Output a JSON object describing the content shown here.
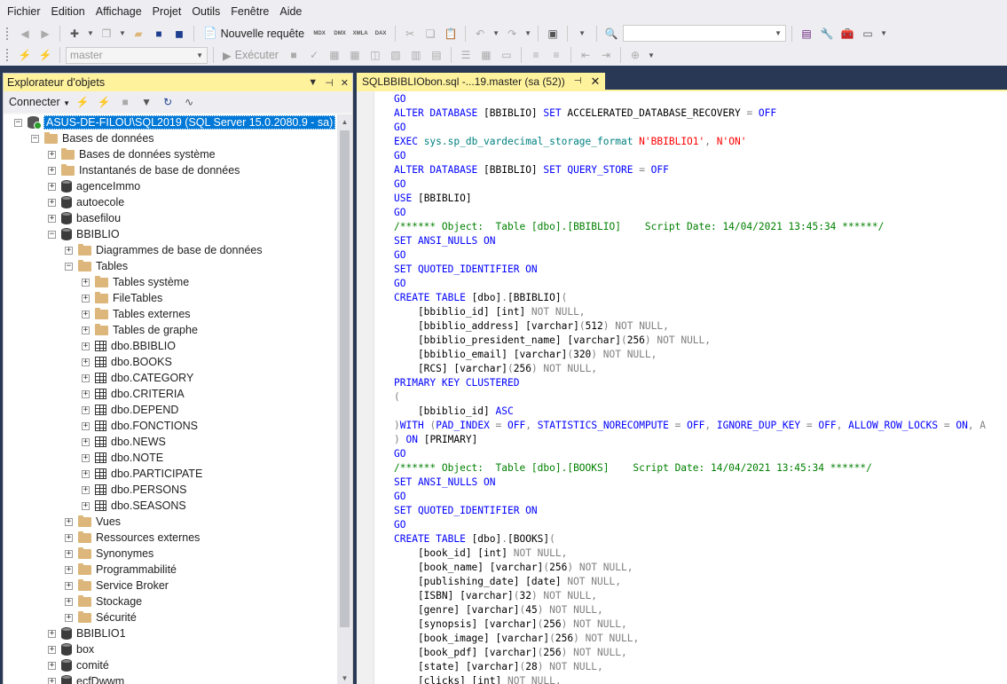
{
  "menu": [
    "Fichier",
    "Edition",
    "Affichage",
    "Projet",
    "Outils",
    "Fenêtre",
    "Aide"
  ],
  "toolbar1": {
    "new_query_label": "Nouvelle requête",
    "mini_labels": [
      "MDX",
      "DMX",
      "XMLA",
      "DAX"
    ],
    "search_value": ""
  },
  "toolbar2": {
    "database_combo": "master",
    "execute_label": "Exécuter"
  },
  "explorer": {
    "title": "Explorateur d'objets",
    "connect_label": "Connecter",
    "tree": [
      {
        "depth": 0,
        "exp": "⊟",
        "icon": "server",
        "label": "ASUS-DE-FILOU\\SQL2019 (SQL Server 15.0.2080.9 - sa)",
        "selected": true
      },
      {
        "depth": 1,
        "exp": "⊟",
        "icon": "folder",
        "label": "Bases de données"
      },
      {
        "depth": 2,
        "exp": "⊞",
        "icon": "folder",
        "label": "Bases de données système"
      },
      {
        "depth": 2,
        "exp": "⊞",
        "icon": "folder",
        "label": "Instantanés de base de données"
      },
      {
        "depth": 2,
        "exp": "⊞",
        "icon": "db",
        "label": "agenceImmo"
      },
      {
        "depth": 2,
        "exp": "⊞",
        "icon": "db",
        "label": "autoecole"
      },
      {
        "depth": 2,
        "exp": "⊞",
        "icon": "db",
        "label": "basefilou"
      },
      {
        "depth": 2,
        "exp": "⊟",
        "icon": "db",
        "label": "BBIBLIO"
      },
      {
        "depth": 3,
        "exp": "⊞",
        "icon": "folder",
        "label": "Diagrammes de base de données"
      },
      {
        "depth": 3,
        "exp": "⊟",
        "icon": "folder",
        "label": "Tables"
      },
      {
        "depth": 4,
        "exp": "⊞",
        "icon": "folder",
        "label": "Tables système"
      },
      {
        "depth": 4,
        "exp": "⊞",
        "icon": "folder",
        "label": "FileTables"
      },
      {
        "depth": 4,
        "exp": "⊞",
        "icon": "folder",
        "label": "Tables externes"
      },
      {
        "depth": 4,
        "exp": "⊞",
        "icon": "folder",
        "label": "Tables de graphe"
      },
      {
        "depth": 4,
        "exp": "⊞",
        "icon": "table",
        "label": "dbo.BBIBLIO"
      },
      {
        "depth": 4,
        "exp": "⊞",
        "icon": "table",
        "label": "dbo.BOOKS"
      },
      {
        "depth": 4,
        "exp": "⊞",
        "icon": "table",
        "label": "dbo.CATEGORY"
      },
      {
        "depth": 4,
        "exp": "⊞",
        "icon": "table",
        "label": "dbo.CRITERIA"
      },
      {
        "depth": 4,
        "exp": "⊞",
        "icon": "table",
        "label": "dbo.DEPEND"
      },
      {
        "depth": 4,
        "exp": "⊞",
        "icon": "table",
        "label": "dbo.FONCTIONS"
      },
      {
        "depth": 4,
        "exp": "⊞",
        "icon": "table",
        "label": "dbo.NEWS"
      },
      {
        "depth": 4,
        "exp": "⊞",
        "icon": "table",
        "label": "dbo.NOTE"
      },
      {
        "depth": 4,
        "exp": "⊞",
        "icon": "table",
        "label": "dbo.PARTICIPATE"
      },
      {
        "depth": 4,
        "exp": "⊞",
        "icon": "table",
        "label": "dbo.PERSONS"
      },
      {
        "depth": 4,
        "exp": "⊞",
        "icon": "table",
        "label": "dbo.SEASONS"
      },
      {
        "depth": 3,
        "exp": "⊞",
        "icon": "folder",
        "label": "Vues"
      },
      {
        "depth": 3,
        "exp": "⊞",
        "icon": "folder",
        "label": "Ressources externes"
      },
      {
        "depth": 3,
        "exp": "⊞",
        "icon": "folder",
        "label": "Synonymes"
      },
      {
        "depth": 3,
        "exp": "⊞",
        "icon": "folder",
        "label": "Programmabilité"
      },
      {
        "depth": 3,
        "exp": "⊞",
        "icon": "folder",
        "label": "Service Broker"
      },
      {
        "depth": 3,
        "exp": "⊞",
        "icon": "folder",
        "label": "Stockage"
      },
      {
        "depth": 3,
        "exp": "⊞",
        "icon": "folder",
        "label": "Sécurité"
      },
      {
        "depth": 2,
        "exp": "⊞",
        "icon": "db",
        "label": "BBIBLIO1"
      },
      {
        "depth": 2,
        "exp": "⊞",
        "icon": "db",
        "label": "box"
      },
      {
        "depth": 2,
        "exp": "⊞",
        "icon": "db",
        "label": "comité"
      },
      {
        "depth": 2,
        "exp": "⊞",
        "icon": "db",
        "label": "ecfDwwm"
      }
    ]
  },
  "editor": {
    "tab_title": "SQLBBIBLIObon.sql -...19.master (sa (52))",
    "lines": [
      [
        [
          "kw",
          "GO"
        ]
      ],
      [
        [
          "kw",
          "ALTER DATABASE "
        ],
        [
          "id",
          "[BBIBLIO] "
        ],
        [
          "kw",
          "SET "
        ],
        [
          "id",
          "ACCELERATED_DATABASE_RECOVERY "
        ],
        [
          "gr",
          "= "
        ],
        [
          "kw",
          "OFF"
        ]
      ],
      [
        [
          "kw",
          "GO"
        ]
      ],
      [
        [
          "kw",
          "EXEC "
        ],
        [
          "fn",
          "sys.sp_db_vardecimal_storage_format "
        ],
        [
          "st",
          "N'BBIBLIO1'"
        ],
        [
          "gr",
          ", "
        ],
        [
          "st",
          "N'ON'"
        ]
      ],
      [
        [
          "kw",
          "GO"
        ]
      ],
      [
        [
          "kw",
          "ALTER DATABASE "
        ],
        [
          "id",
          "[BBIBLIO] "
        ],
        [
          "kw",
          "SET "
        ],
        [
          "kw",
          "QUERY_STORE "
        ],
        [
          "gr",
          "= "
        ],
        [
          "kw",
          "OFF"
        ]
      ],
      [
        [
          "kw",
          "GO"
        ]
      ],
      [
        [
          "kw",
          "USE "
        ],
        [
          "id",
          "[BBIBLIO]"
        ]
      ],
      [
        [
          "kw",
          "GO"
        ]
      ],
      [
        [
          "cm",
          "/****** Object:  Table [dbo].[BBIBLIO]    Script Date: 14/04/2021 13:45:34 ******/"
        ]
      ],
      [
        [
          "kw",
          "SET ANSI_NULLS ON"
        ]
      ],
      [
        [
          "kw",
          "GO"
        ]
      ],
      [
        [
          "kw",
          "SET QUOTED_IDENTIFIER ON"
        ]
      ],
      [
        [
          "kw",
          "GO"
        ]
      ],
      [
        [
          "kw",
          "CREATE TABLE "
        ],
        [
          "id",
          "[dbo]"
        ],
        [
          "gr",
          "."
        ],
        [
          "id",
          "[BBIBLIO]"
        ],
        [
          "gr",
          "("
        ]
      ],
      [
        [
          "id",
          "    [bbiblio_id] [int] "
        ],
        [
          "gr",
          "NOT NULL,"
        ]
      ],
      [
        [
          "id",
          "    [bbiblio_address] [varchar]"
        ],
        [
          "gr",
          "("
        ],
        [
          "id",
          "512"
        ],
        [
          "gr",
          ") NOT NULL,"
        ]
      ],
      [
        [
          "id",
          "    [bbiblio_president_name] [varchar]"
        ],
        [
          "gr",
          "("
        ],
        [
          "id",
          "256"
        ],
        [
          "gr",
          ") NOT NULL,"
        ]
      ],
      [
        [
          "id",
          "    [bbiblio_email] [varchar]"
        ],
        [
          "gr",
          "("
        ],
        [
          "id",
          "320"
        ],
        [
          "gr",
          ") NOT NULL,"
        ]
      ],
      [
        [
          "id",
          "    [RCS] [varchar]"
        ],
        [
          "gr",
          "("
        ],
        [
          "id",
          "256"
        ],
        [
          "gr",
          ") NOT NULL,"
        ]
      ],
      [
        [
          "kw",
          "PRIMARY KEY CLUSTERED"
        ]
      ],
      [
        [
          "gr",
          "("
        ]
      ],
      [
        [
          "id",
          "    [bbiblio_id] "
        ],
        [
          "kw",
          "ASC"
        ]
      ],
      [
        [
          "gr",
          ")"
        ],
        [
          "kw",
          "WITH "
        ],
        [
          "gr",
          "("
        ],
        [
          "kw",
          "PAD_INDEX "
        ],
        [
          "gr",
          "= "
        ],
        [
          "kw",
          "OFF"
        ],
        [
          "gr",
          ", "
        ],
        [
          "kw",
          "STATISTICS_NORECOMPUTE "
        ],
        [
          "gr",
          "= "
        ],
        [
          "kw",
          "OFF"
        ],
        [
          "gr",
          ", "
        ],
        [
          "kw",
          "IGNORE_DUP_KEY "
        ],
        [
          "gr",
          "= "
        ],
        [
          "kw",
          "OFF"
        ],
        [
          "gr",
          ", "
        ],
        [
          "kw",
          "ALLOW_ROW_LOCKS "
        ],
        [
          "gr",
          "= "
        ],
        [
          "kw",
          "ON"
        ],
        [
          "gr",
          ", A"
        ]
      ],
      [
        [
          "gr",
          ") "
        ],
        [
          "kw",
          "ON "
        ],
        [
          "id",
          "[PRIMARY]"
        ]
      ],
      [
        [
          "kw",
          "GO"
        ]
      ],
      [
        [
          "cm",
          "/****** Object:  Table [dbo].[BOOKS]    Script Date: 14/04/2021 13:45:34 ******/"
        ]
      ],
      [
        [
          "kw",
          "SET ANSI_NULLS ON"
        ]
      ],
      [
        [
          "kw",
          "GO"
        ]
      ],
      [
        [
          "kw",
          "SET QUOTED_IDENTIFIER ON"
        ]
      ],
      [
        [
          "kw",
          "GO"
        ]
      ],
      [
        [
          "kw",
          "CREATE TABLE "
        ],
        [
          "id",
          "[dbo]"
        ],
        [
          "gr",
          "."
        ],
        [
          "id",
          "[BOOKS]"
        ],
        [
          "gr",
          "("
        ]
      ],
      [
        [
          "id",
          "    [book_id] [int] "
        ],
        [
          "gr",
          "NOT NULL,"
        ]
      ],
      [
        [
          "id",
          "    [book_name] [varchar]"
        ],
        [
          "gr",
          "("
        ],
        [
          "id",
          "256"
        ],
        [
          "gr",
          ") NOT NULL,"
        ]
      ],
      [
        [
          "id",
          "    [publishing_date] [date] "
        ],
        [
          "gr",
          "NOT NULL,"
        ]
      ],
      [
        [
          "id",
          "    [ISBN] [varchar]"
        ],
        [
          "gr",
          "("
        ],
        [
          "id",
          "32"
        ],
        [
          "gr",
          ") NOT NULL,"
        ]
      ],
      [
        [
          "id",
          "    [genre] [varchar]"
        ],
        [
          "gr",
          "("
        ],
        [
          "id",
          "45"
        ],
        [
          "gr",
          ") NOT NULL,"
        ]
      ],
      [
        [
          "id",
          "    [synopsis] [varchar]"
        ],
        [
          "gr",
          "("
        ],
        [
          "id",
          "256"
        ],
        [
          "gr",
          ") NOT NULL,"
        ]
      ],
      [
        [
          "id",
          "    [book_image] [varchar]"
        ],
        [
          "gr",
          "("
        ],
        [
          "id",
          "256"
        ],
        [
          "gr",
          ") NOT NULL,"
        ]
      ],
      [
        [
          "id",
          "    [book_pdf] [varchar]"
        ],
        [
          "gr",
          "("
        ],
        [
          "id",
          "256"
        ],
        [
          "gr",
          ") NOT NULL,"
        ]
      ],
      [
        [
          "id",
          "    [state] [varchar]"
        ],
        [
          "gr",
          "("
        ],
        [
          "id",
          "28"
        ],
        [
          "gr",
          ") NOT NULL,"
        ]
      ],
      [
        [
          "id",
          "    [clicks] [int] "
        ],
        [
          "gr",
          "NOT NULL,"
        ]
      ]
    ]
  }
}
